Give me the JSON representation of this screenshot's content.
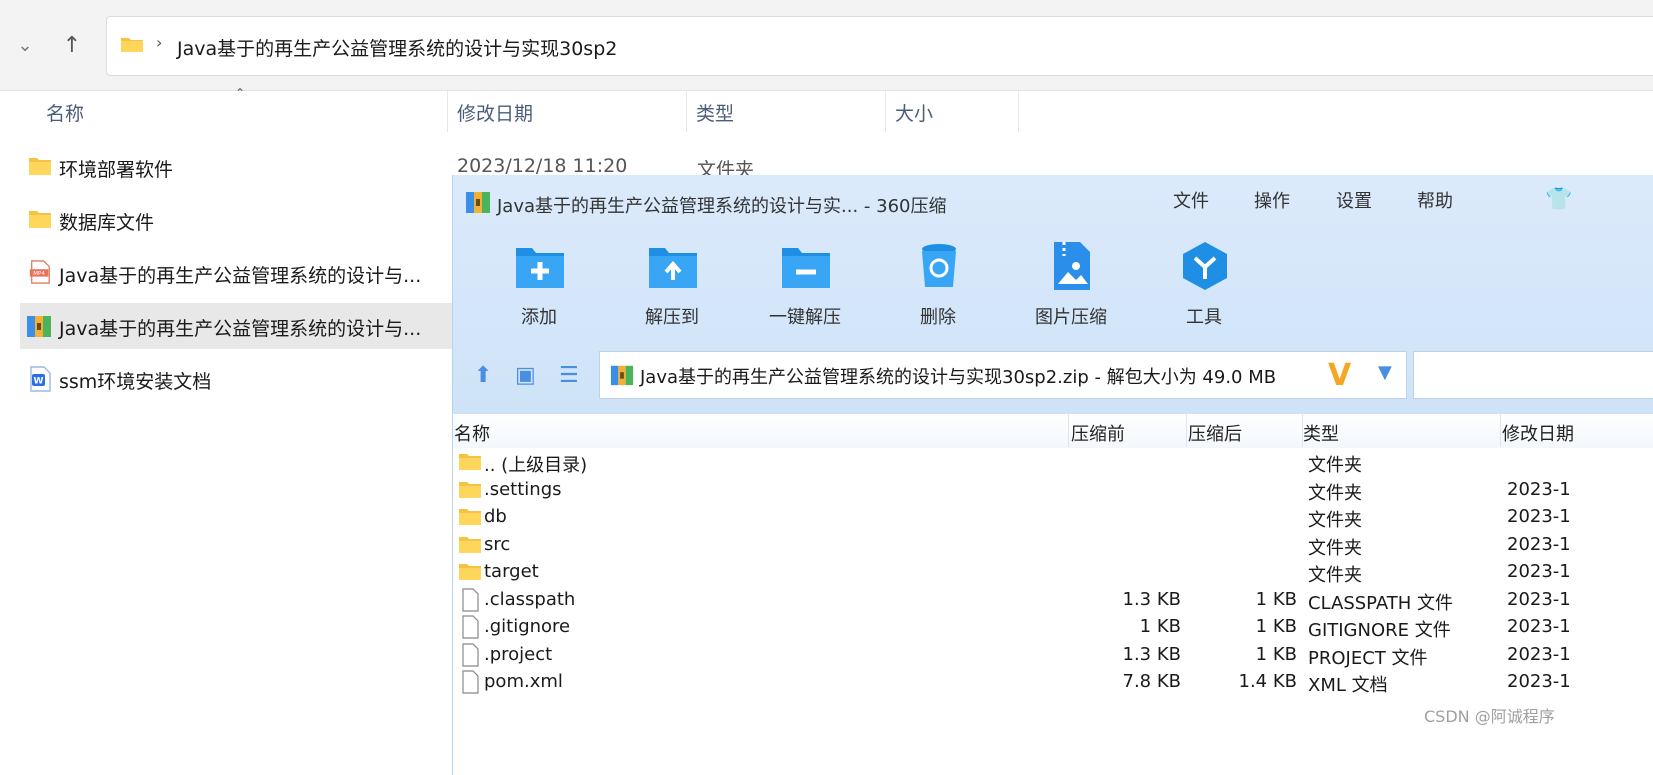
{
  "explorer": {
    "address": {
      "path": "Java基于的再生产公益管理系统的设计与实现30sp2",
      "separator": "›"
    },
    "nav": {
      "down_glyph": "⌄",
      "up_glyph": "↑"
    },
    "columns": {
      "name": "名称",
      "modified": "修改日期",
      "type": "类型",
      "size": "大小"
    },
    "files": [
      {
        "name": "环境部署软件",
        "icon": "folder-icon",
        "modified": "2023/12/18 11:20",
        "type": "文件夹"
      },
      {
        "name": "数据库文件",
        "icon": "folder-icon"
      },
      {
        "name": "Java基于的再生产公益管理系统的设计与...",
        "icon": "mp4-icon"
      },
      {
        "name": "Java基于的再生产公益管理系统的设计与...",
        "icon": "zip-archive-icon",
        "selected": true
      },
      {
        "name": "ssm环境安装文档",
        "icon": "word-doc-icon"
      }
    ]
  },
  "zip_window": {
    "title": "Java基于的再生产公益管理系统的设计与实... - 360压缩",
    "menu": [
      "文件",
      "操作",
      "设置",
      "帮助"
    ],
    "toolbar": [
      {
        "label": "添加",
        "icon": "add-folder-icon"
      },
      {
        "label": "解压到",
        "icon": "extract-to-icon"
      },
      {
        "label": "一键解压",
        "icon": "one-click-extract-icon"
      },
      {
        "label": "删除",
        "icon": "delete-bin-icon"
      },
      {
        "label": "图片压缩",
        "icon": "image-compress-icon"
      },
      {
        "label": "工具",
        "icon": "tools-icon"
      }
    ],
    "path_text": "Java基于的再生产公益管理系统的设计与实现30sp2.zip - 解包大小为 49.0 MB",
    "columns": {
      "name": "名称",
      "before": "压缩前",
      "after": "压缩后",
      "type": "类型",
      "modified": "修改日期"
    },
    "entries": [
      {
        "name": ".. (上级目录)",
        "icon": "folder-icon",
        "before": "",
        "after": "",
        "type": "文件夹",
        "date": ""
      },
      {
        "name": ".settings",
        "icon": "folder-icon",
        "before": "",
        "after": "",
        "type": "文件夹",
        "date": "2023-1"
      },
      {
        "name": "db",
        "icon": "folder-icon",
        "before": "",
        "after": "",
        "type": "文件夹",
        "date": "2023-1"
      },
      {
        "name": "src",
        "icon": "folder-icon",
        "before": "",
        "after": "",
        "type": "文件夹",
        "date": "2023-1"
      },
      {
        "name": "target",
        "icon": "folder-icon",
        "before": "",
        "after": "",
        "type": "文件夹",
        "date": "2023-1"
      },
      {
        "name": ".classpath",
        "icon": "file-icon",
        "before": "1.3 KB",
        "after": "1 KB",
        "type": "CLASSPATH 文件",
        "date": "2023-1"
      },
      {
        "name": ".gitignore",
        "icon": "file-icon",
        "before": "1 KB",
        "after": "1 KB",
        "type": "GITIGNORE 文件",
        "date": "2023-1"
      },
      {
        "name": ".project",
        "icon": "file-icon",
        "before": "1.3 KB",
        "after": "1 KB",
        "type": "PROJECT 文件",
        "date": "2023-1"
      },
      {
        "name": "pom.xml",
        "icon": "file-icon",
        "before": "7.8 KB",
        "after": "1.4 KB",
        "type": "XML 文档",
        "date": "2023-1"
      }
    ]
  },
  "watermark": "CSDN @阿诚程序"
}
